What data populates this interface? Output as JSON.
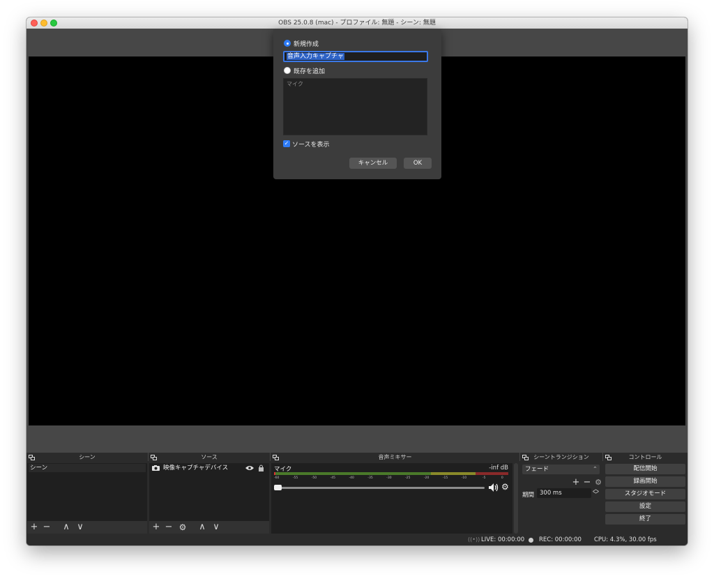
{
  "window": {
    "title": "OBS 25.0.8 (mac) - プロファイル: 無題 - シーン: 無題"
  },
  "colors": {
    "accent": "#2f7cf6",
    "canvas": "#000000",
    "panel": "#2b2b2b"
  },
  "dialog": {
    "new_label": "新規作成",
    "name_value": "音声入力キャプチャ",
    "existing_label": "既存を追加",
    "existing_items": [
      "マイク"
    ],
    "visible_label": "ソースを表示",
    "cancel_label": "キャンセル",
    "ok_label": "OK"
  },
  "docks": {
    "scenes": {
      "title": "シーン",
      "items": [
        "シーン"
      ]
    },
    "sources": {
      "title": "ソース",
      "items": [
        {
          "icon": "camera-icon",
          "name": "映像キャプチャデバイス"
        }
      ]
    },
    "mixer": {
      "title": "音声ミキサー",
      "channel": "マイク",
      "level": "-inf dB",
      "ticks": [
        "-60",
        "-55",
        "-50",
        "-45",
        "-40",
        "-35",
        "-30",
        "-25",
        "-20",
        "-15",
        "-10",
        "-5",
        "0"
      ]
    },
    "transitions": {
      "title": "シーントランジション",
      "transition": "フェード",
      "duration_label": "期間",
      "duration_value": "300 ms"
    },
    "controls": {
      "title": "コントロール",
      "buttons": [
        "配信開始",
        "録画開始",
        "スタジオモード",
        "設定",
        "終了"
      ]
    }
  },
  "status": {
    "live": "LIVE: 00:00:00",
    "rec": "REC: 00:00:00",
    "cpu": "CPU: 4.3%, 30.00 fps"
  }
}
